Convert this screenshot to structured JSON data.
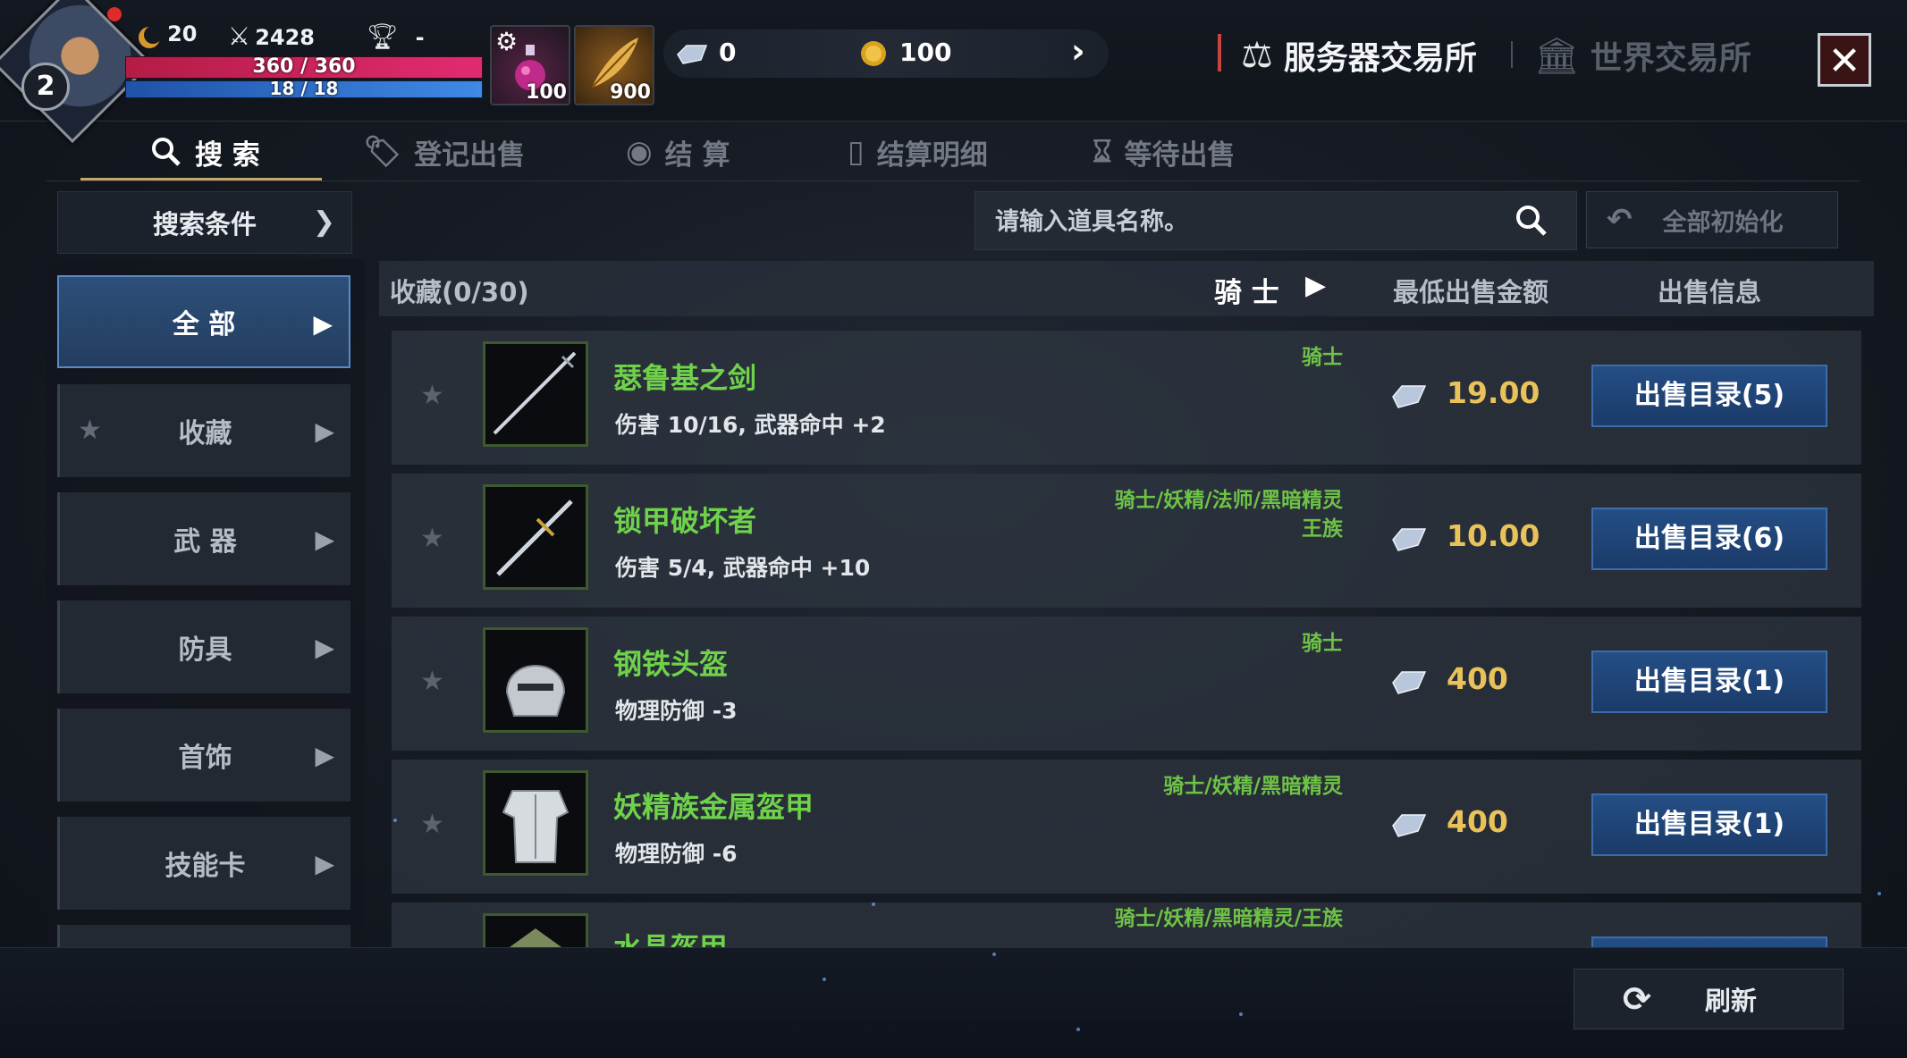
{
  "player": {
    "level": "2",
    "coin_count": "20",
    "power": "2428",
    "rank": "-",
    "hp": "360 / 360",
    "mp": "18 / 18"
  },
  "slots": [
    {
      "name": "potion",
      "count": "100"
    },
    {
      "name": "feather",
      "count": "900"
    }
  ],
  "currency": {
    "diamond": "0",
    "gold": "100"
  },
  "exchange_tabs": {
    "server": "服务器交易所",
    "world": "世界交易所"
  },
  "sub_tabs": {
    "search": "搜 索",
    "register": "登记出售",
    "settle": "结 算",
    "settle_detail": "结算明细",
    "pending": "等待出售"
  },
  "filter": {
    "label": "搜索条件"
  },
  "categories": [
    {
      "label": "全 部"
    },
    {
      "label": "收藏"
    },
    {
      "label": "武 器"
    },
    {
      "label": "防具"
    },
    {
      "label": "首饰"
    },
    {
      "label": "技能卡"
    }
  ],
  "search": {
    "placeholder": "请输入道具名称。",
    "reset": "全部初始化"
  },
  "list_header": {
    "favorites": "收藏(0/30)",
    "class_filter": "骑 士",
    "min_price": "最低出售金额",
    "sale_info": "出售信息"
  },
  "items": [
    {
      "name": "瑟鲁基之剑",
      "stat": "伤害 10/16, 武器命中 +2",
      "class": "骑士",
      "class2": "",
      "price": "19.00",
      "button": "出售目录(5)"
    },
    {
      "name": "锁甲破坏者",
      "stat": "伤害 5/4, 武器命中 +10",
      "class": "骑士/妖精/法师/黑暗精灵",
      "class2": "王族",
      "price": "10.00",
      "button": "出售目录(6)"
    },
    {
      "name": "钢铁头盔",
      "stat": "物理防御 -3",
      "class": "骑士",
      "class2": "",
      "price": "400",
      "button": "出售目录(1)"
    },
    {
      "name": "妖精族金属盔甲",
      "stat": "物理防御 -6",
      "class": "骑士/妖精/黑暗精灵",
      "class2": "",
      "price": "400",
      "button": "出售目录(1)"
    },
    {
      "name": "水晶盔甲",
      "stat": "",
      "class": "骑士/妖精/黑暗精灵/王族",
      "class2": "",
      "price": "",
      "button": ""
    }
  ],
  "refresh": {
    "label": "刷新"
  },
  "colors": {
    "item_name": "#6fd24a",
    "price": "#e9c25a",
    "accent_blue": "#244e86",
    "tab_underline": "#c7a765"
  }
}
